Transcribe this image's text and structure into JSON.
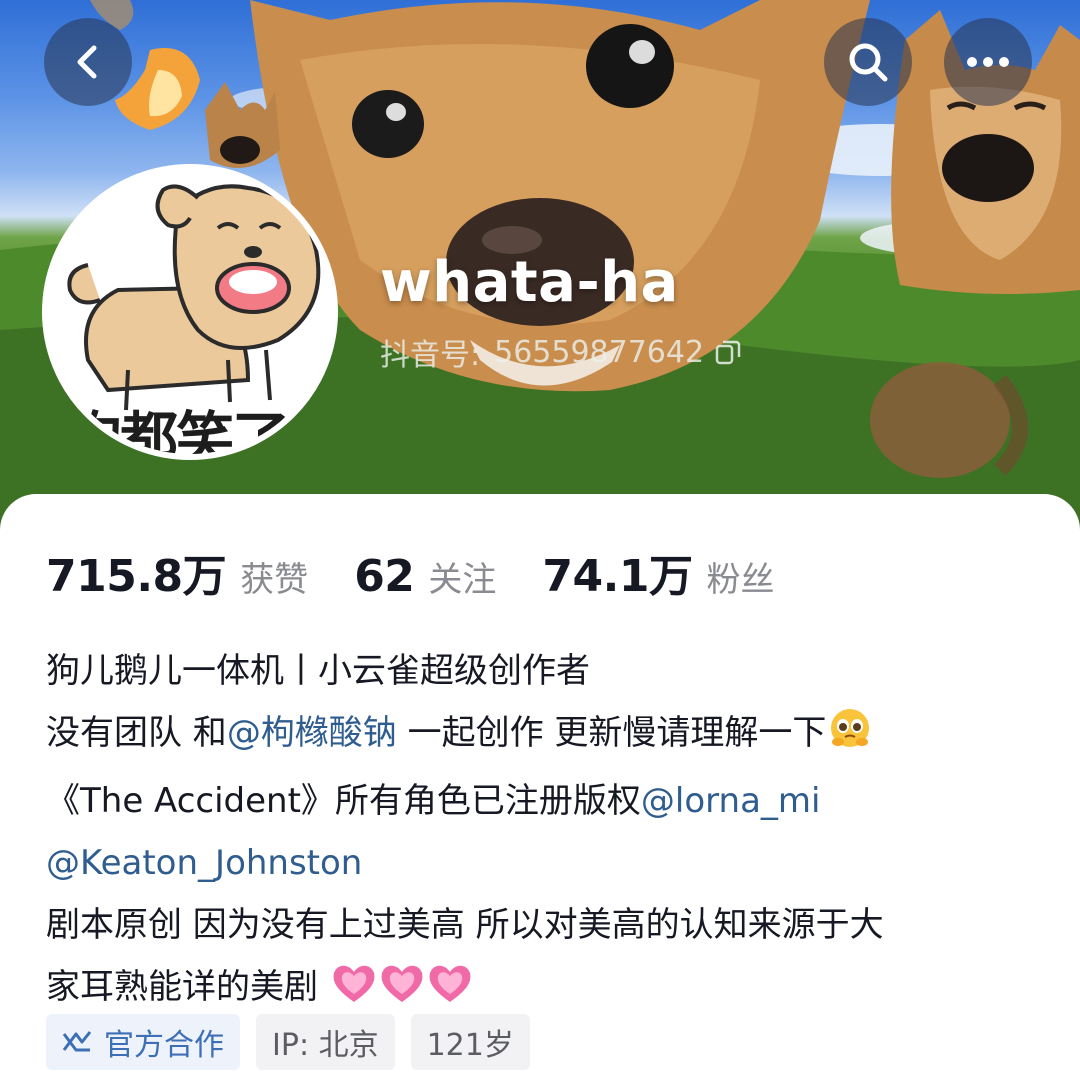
{
  "header": {
    "back_icon": "chevron-left-icon",
    "search_icon": "search-icon",
    "more_icon": "more-horizontal-icon"
  },
  "profile": {
    "nickname": "whata-ha",
    "douyin_id_label": "抖音号:",
    "douyin_id": "56559877642",
    "avatar_caption": "狗都笑了"
  },
  "stats": [
    {
      "value": "715.8万",
      "label": "获赞"
    },
    {
      "value": "62",
      "label": "关注"
    },
    {
      "value": "74.1万",
      "label": "粉丝"
    }
  ],
  "bio": {
    "line1": "狗儿鹅儿一体机丨小云雀超级创作者",
    "line2_prefix": "没有团队 和",
    "line2_mention": "@枸橼酸钠",
    "line2_suffix": " 一起创作 更新慢请理解一下",
    "line3_prefix": "《The Accident》所有角色已注册版权",
    "line3_mention": "@lorna_mi",
    "line4_mention": "@Keaton_Johnston",
    "line5": "剧本原创 因为没有上过美高 所以对美高的认知来源于大",
    "line6": "家耳熟能详的美剧 "
  },
  "tags": {
    "official": "官方合作",
    "ip": "IP:  北京",
    "age": "121岁"
  },
  "colors": {
    "mention": "#2f5d8f",
    "official_tag": "#3d6fb6",
    "text_primary": "#161823",
    "text_secondary": "#8a8b91"
  }
}
